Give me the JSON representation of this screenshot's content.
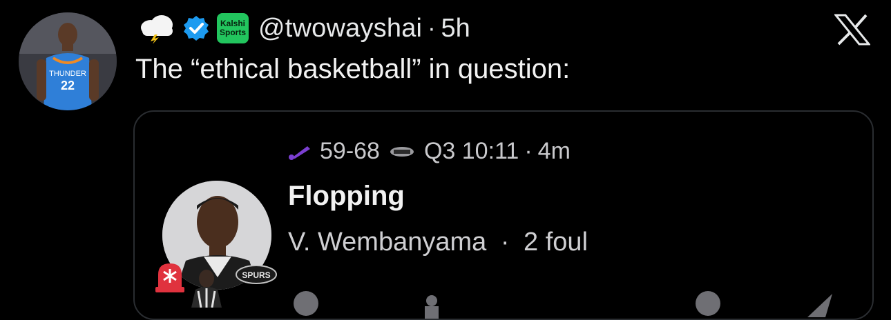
{
  "tweet": {
    "handle": "@twowayshai",
    "dot": "·",
    "time": "5h",
    "kalshi_line1": "Kalshi",
    "kalshi_line2": "Sports",
    "text": "The “ethical basketball” in question:",
    "avatar_jersey_team": "THUNDER",
    "avatar_jersey_number": "22"
  },
  "card": {
    "score": "59-68",
    "period_clock": "Q3 10:11",
    "dot": "·",
    "ago": "4m",
    "event": "Flopping",
    "player": "V. Wembanyama",
    "fouls": "2 foul",
    "logo_text": "SPURS"
  },
  "icons": {
    "weather": "cloud-lightning-icon",
    "verified": "verified-badge-icon",
    "close": "x-logo-icon",
    "jazz": "jazz-note-icon",
    "spurs": "spurs-logo-icon",
    "siren": "siren-icon"
  },
  "colors": {
    "verified": "#1d9bf0",
    "kalshi": "#22c55e",
    "jazz": "#7b3fd1",
    "thunder": "#2f7fd8",
    "siren": "#e0323e"
  }
}
